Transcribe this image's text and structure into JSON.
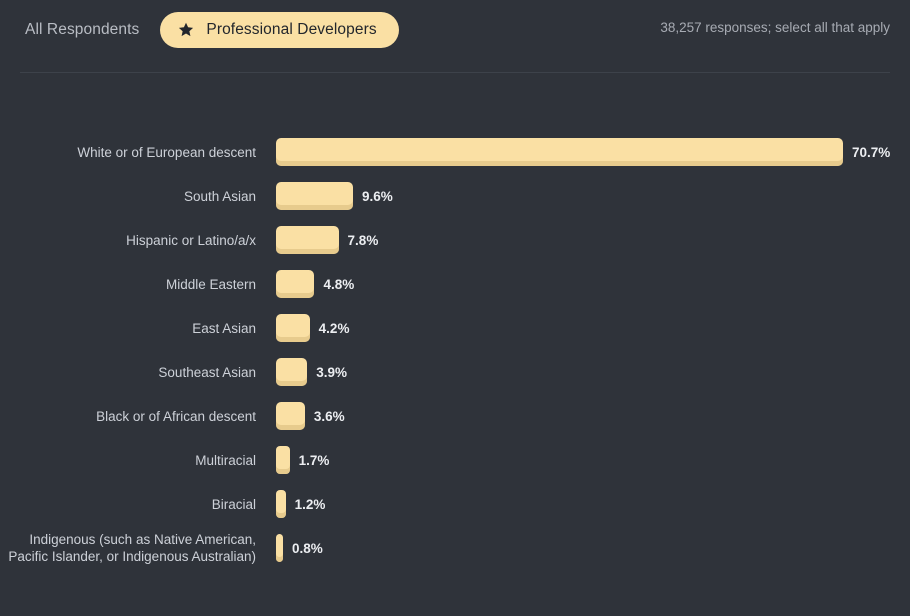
{
  "header": {
    "tabs": [
      {
        "label": "All Respondents",
        "active": false,
        "icon": null
      },
      {
        "label": "Professional Developers",
        "active": true,
        "icon": "star-icon"
      }
    ],
    "responses_note": "38,257 responses; select all that apply"
  },
  "colors": {
    "background": "#2f333a",
    "bar": "#fae0a4",
    "bar_shadow": "#d9c08a",
    "label_text": "#cdd1d8",
    "value_text": "#eceef1",
    "note_text": "#a7abb3",
    "divider": "#3d424a",
    "pill_text": "#22262c"
  },
  "chart_data": {
    "type": "bar",
    "orientation": "horizontal",
    "title": "",
    "xlabel": "",
    "ylabel": "",
    "xlim": [
      0,
      70.7
    ],
    "grid": false,
    "legend": null,
    "value_suffix": "%",
    "categories": [
      "White or of European descent",
      "South Asian",
      "Hispanic or Latino/a/x",
      "Middle Eastern",
      "East Asian",
      "Southeast Asian",
      "Black or of African descent",
      "Multiracial",
      "Biracial",
      "Indigenous (such as Native American, Pacific Islander, or Indigenous Australian)"
    ],
    "values": [
      70.7,
      9.6,
      7.8,
      4.8,
      4.2,
      3.9,
      3.6,
      1.7,
      1.2,
      0.8
    ],
    "value_labels": [
      "70.7%",
      "9.6%",
      "7.8%",
      "4.8%",
      "4.2%",
      "3.9%",
      "3.6%",
      "1.7%",
      "1.2%",
      "0.8%"
    ]
  }
}
